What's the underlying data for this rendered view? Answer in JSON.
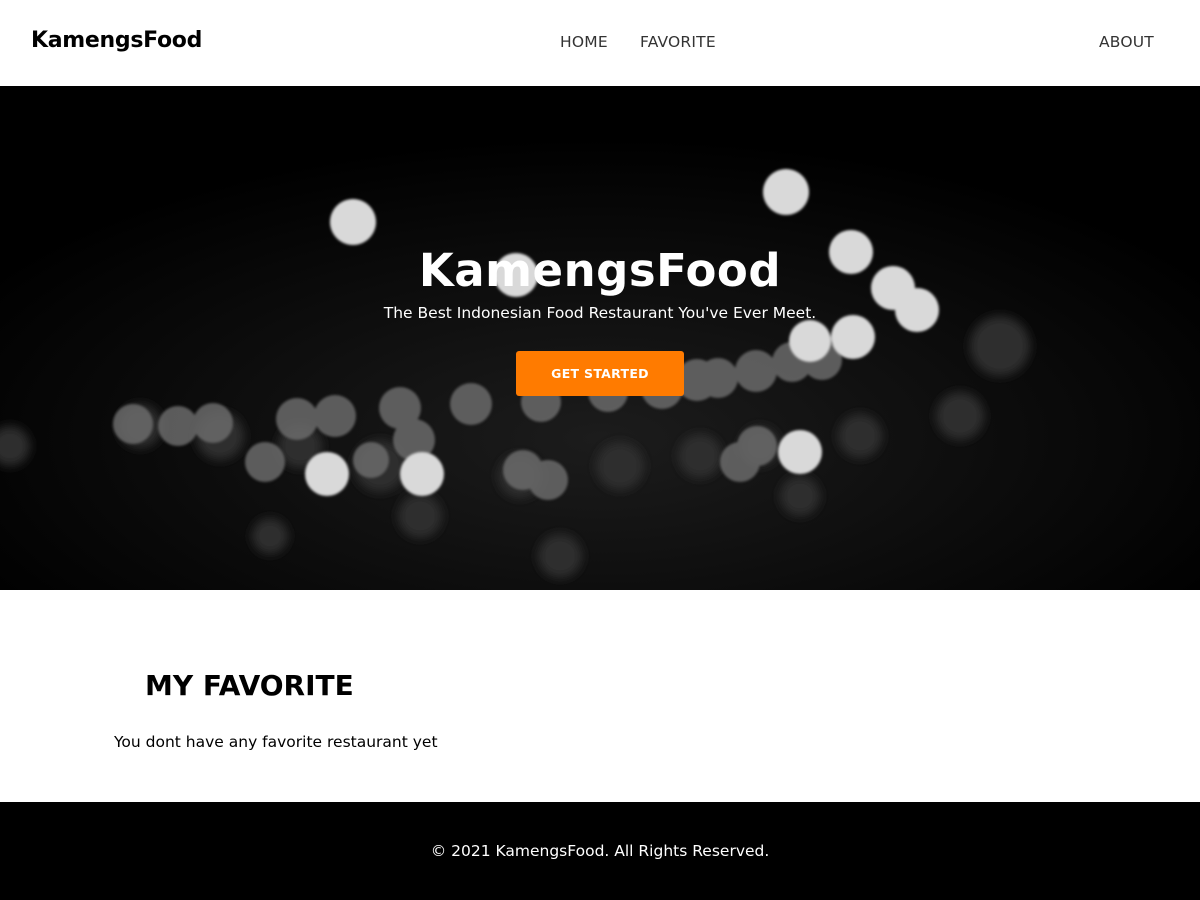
{
  "header": {
    "brand": "KamengsFood",
    "nav": {
      "home": "HOME",
      "favorite": "FAVORITE",
      "about": "ABOUT"
    }
  },
  "hero": {
    "title": "KamengsFood",
    "tagline": "The Best Indonesian Food Restaurant You've Ever Meet.",
    "cta_label": "GET STARTED"
  },
  "favorites": {
    "heading": "MY FAVORITE",
    "empty_message": "You dont have any favorite restaurant yet"
  },
  "footer": {
    "copyright": "© 2021 KamengsFood. All Rights Reserved."
  },
  "colors": {
    "accent": "#ff7b00",
    "hero_background": "#000000",
    "footer_background": "#000000"
  }
}
